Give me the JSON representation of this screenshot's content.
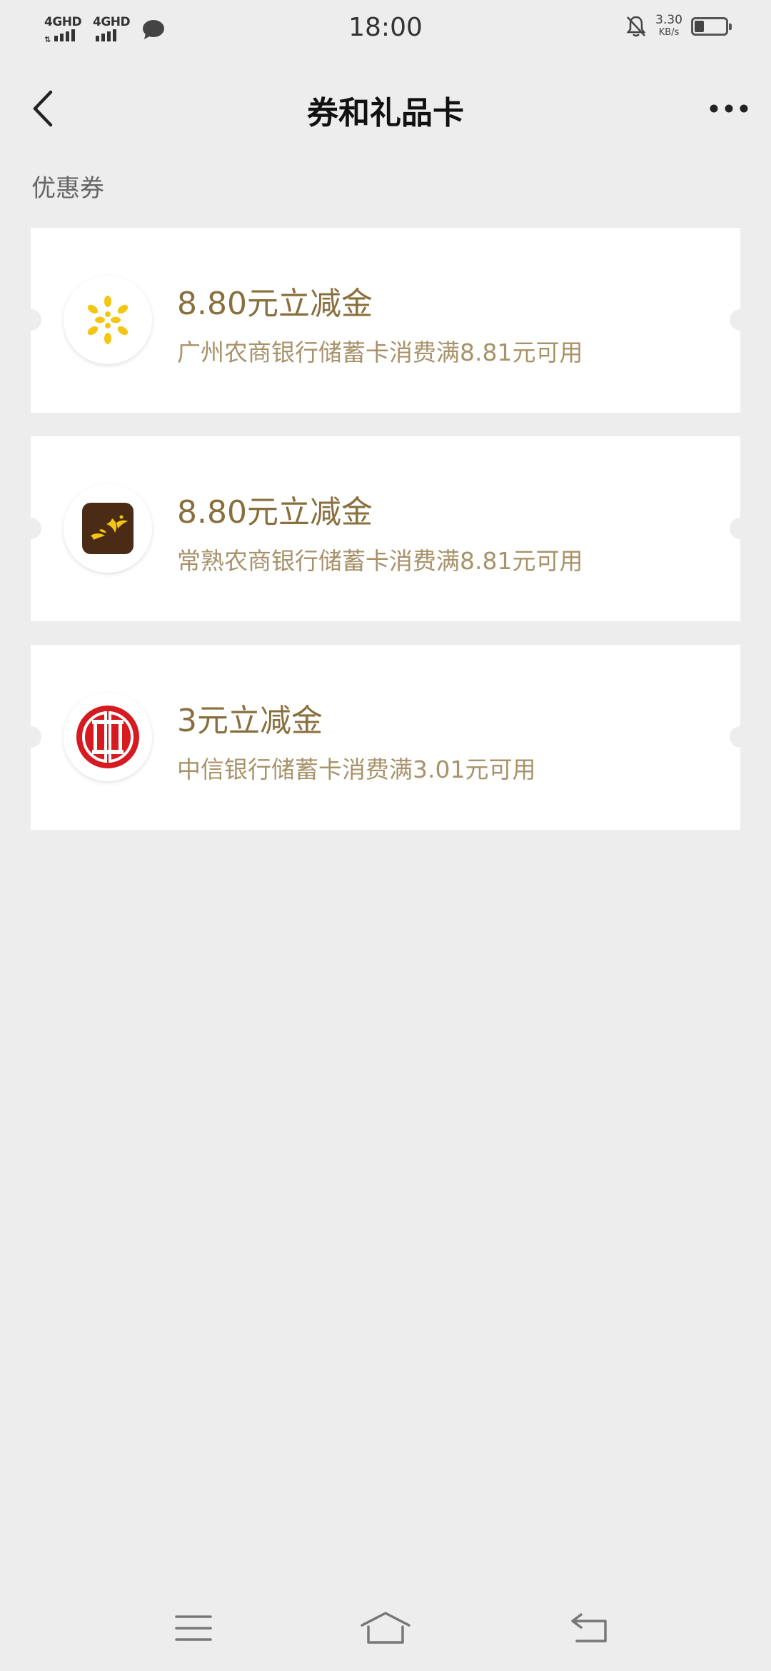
{
  "status_bar": {
    "signal1": "4GHD",
    "signal2": "4GHD",
    "time": "18:00",
    "speed_value": "3.30",
    "speed_unit": "KB/s",
    "battery_level": 0.3
  },
  "nav": {
    "title": "券和礼品卡",
    "back_icon": "chevron-left-icon",
    "more_icon": "more-dots-icon"
  },
  "section": {
    "label": "优惠券"
  },
  "coupons": [
    {
      "title": "8.80元立减金",
      "desc": "广州农商银行储蓄卡消费满8.81元可用",
      "logo": "guangzhou-rural-bank-logo"
    },
    {
      "title": "8.80元立减金",
      "desc": "常熟农商银行储蓄卡消费满8.81元可用",
      "logo": "changshu-rural-bank-logo"
    },
    {
      "title": "3元立减金",
      "desc": "中信银行储蓄卡消费满3.01元可用",
      "logo": "citic-bank-logo"
    }
  ],
  "colors": {
    "background": "#ededed",
    "card": "#ffffff",
    "coupon_title": "#8a6f3e",
    "coupon_desc": "#a8926a",
    "citic_red": "#d71920",
    "gold": "#f3c614",
    "changshu_brown": "#4a2c16"
  },
  "bottom_nav": {
    "menu_icon": "menu-icon",
    "home_icon": "home-icon",
    "back_icon": "return-icon"
  }
}
